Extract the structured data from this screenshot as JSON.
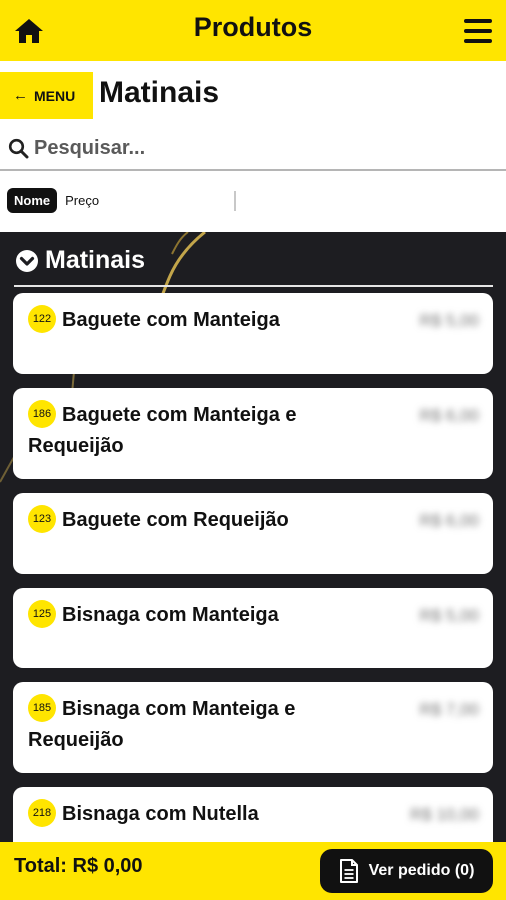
{
  "header": {
    "title": "Produtos",
    "home_icon": "home-icon",
    "menu_icon": "hamburger-menu-icon"
  },
  "nav": {
    "back_label": "MENU",
    "back_arrow": "←",
    "category_title": "Matinais"
  },
  "search": {
    "placeholder": "Pesquisar...",
    "value": ""
  },
  "sort": {
    "active": "Nome",
    "other": "Preço"
  },
  "section": {
    "title": "Matinais"
  },
  "products": [
    {
      "code": "122",
      "name": "Baguete com Manteiga",
      "price": "R$ 5,00"
    },
    {
      "code": "186",
      "name": "Baguete com Manteiga e Requeijão",
      "price": "R$ 6,00"
    },
    {
      "code": "123",
      "name": "Baguete com Requeijão",
      "price": "R$ 6,00"
    },
    {
      "code": "125",
      "name": "Bisnaga com Manteiga",
      "price": "R$ 5,00"
    },
    {
      "code": "185",
      "name": "Bisnaga com Manteiga e Requeijão",
      "price": "R$ 7,00"
    },
    {
      "code": "218",
      "name": "Bisnaga com Nutella",
      "price": "R$ 10,00"
    }
  ],
  "footer": {
    "total_label": "Total: R$ 0,00",
    "order_button": "Ver pedido (0)"
  },
  "colors": {
    "accent": "#ffe500",
    "dark_bg": "#1d1d21",
    "text": "#111111"
  }
}
